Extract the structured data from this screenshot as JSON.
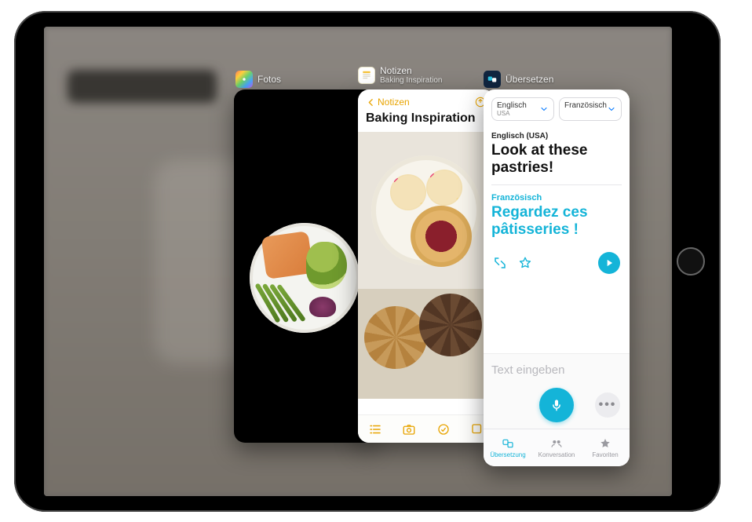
{
  "switcher": {
    "fotos": {
      "label": "Fotos"
    },
    "notizen": {
      "label": "Notizen",
      "subtitle": "Baking Inspiration"
    },
    "uebersetzen": {
      "label": "Übersetzen"
    }
  },
  "notizen": {
    "back_label": "Notizen",
    "note_title": "Baking Inspiration"
  },
  "translate": {
    "lang_src": {
      "name": "Englisch",
      "region": "USA"
    },
    "lang_dst": {
      "name": "Französisch"
    },
    "src_label": "Englisch (USA)",
    "src_text": "Look at these pastries!",
    "dst_label": "Französisch",
    "dst_text": "Regardez ces pâtisseries !",
    "input_placeholder": "Text eingeben",
    "tabs": {
      "translate": "Übersetzung",
      "conversation": "Konversation",
      "favorites": "Favoriten"
    }
  }
}
